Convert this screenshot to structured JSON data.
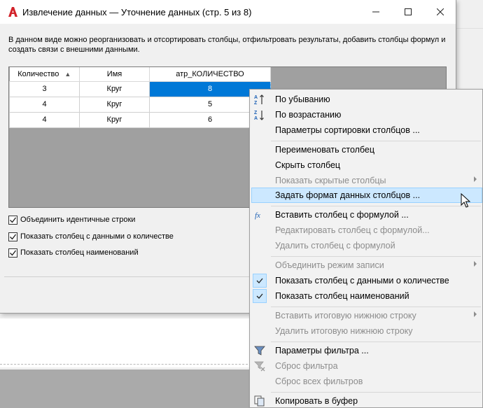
{
  "window": {
    "title": "Извлечение данных — Уточнение данных (стр. 5 из 8)",
    "controls": {
      "minimize": "—",
      "maximize": "☐",
      "close": "✕"
    }
  },
  "description": "В данном виде можно реорганизовать и отсортировать столбцы, отфильтровать результаты, добавить столбцы формул и создать связи с внешними данными.",
  "grid": {
    "columns": [
      "Количество",
      "Имя",
      "атр_КОЛИЧЕСТВО"
    ],
    "sort_indicator": "▲",
    "rows": [
      [
        "3",
        "Круг",
        "8"
      ],
      [
        "4",
        "Круг",
        "5"
      ],
      [
        "4",
        "Круг",
        "6"
      ]
    ],
    "selected_cell": {
      "row": 0,
      "col": 2
    }
  },
  "checkboxes": [
    {
      "label": "Объединить идентичные строки",
      "checked": true
    },
    {
      "label": "Показать столбец с данными о количестве",
      "checked": true
    },
    {
      "label": "Показать столбец наименований",
      "checked": true
    }
  ],
  "menu": {
    "items": [
      {
        "label": "По убыванию",
        "icon": "sort-descending-icon",
        "disabled": false
      },
      {
        "label": "По возрастанию",
        "icon": "sort-ascending-icon",
        "disabled": false
      },
      {
        "label": "Параметры сортировки столбцов ...",
        "disabled": false
      },
      {
        "label": "Переименовать столбец",
        "disabled": false
      },
      {
        "label": "Скрыть столбец",
        "disabled": false
      },
      {
        "label": "Показать скрытые столбцы",
        "disabled": true,
        "submenu": true
      },
      {
        "label": "Задать формат данных столбцов ...",
        "disabled": false,
        "highlighted": true
      },
      {
        "label": "Вставить столбец с формулой ...",
        "icon": "formula-icon",
        "disabled": false
      },
      {
        "label": "Редактировать столбец с формулой...",
        "disabled": true
      },
      {
        "label": "Удалить столбец с формулой",
        "disabled": true
      },
      {
        "label": "Объединить режим записи",
        "disabled": true,
        "submenu": true
      },
      {
        "label": "Показать столбец с данными о количестве",
        "checked": true,
        "disabled": false
      },
      {
        "label": "Показать столбец наименований",
        "checked": true,
        "disabled": false
      },
      {
        "label": "Вставить итоговую нижнюю строку",
        "disabled": true,
        "submenu": true
      },
      {
        "label": "Удалить итоговую нижнюю строку",
        "disabled": true
      },
      {
        "label": "Параметры фильтра ...",
        "icon": "filter-icon",
        "disabled": false
      },
      {
        "label": "Сброс фильтра",
        "icon": "clear-filter-icon",
        "disabled": true
      },
      {
        "label": "Сброс всех фильтров",
        "disabled": true
      },
      {
        "label": "Копировать в буфер",
        "icon": "copy-icon",
        "disabled": false
      }
    ]
  },
  "colors": {
    "selection": "#0078d7",
    "menu_highlight": "#cce8ff",
    "menu_highlight_border": "#99d1ff",
    "app_icon_red": "#d2232a"
  }
}
